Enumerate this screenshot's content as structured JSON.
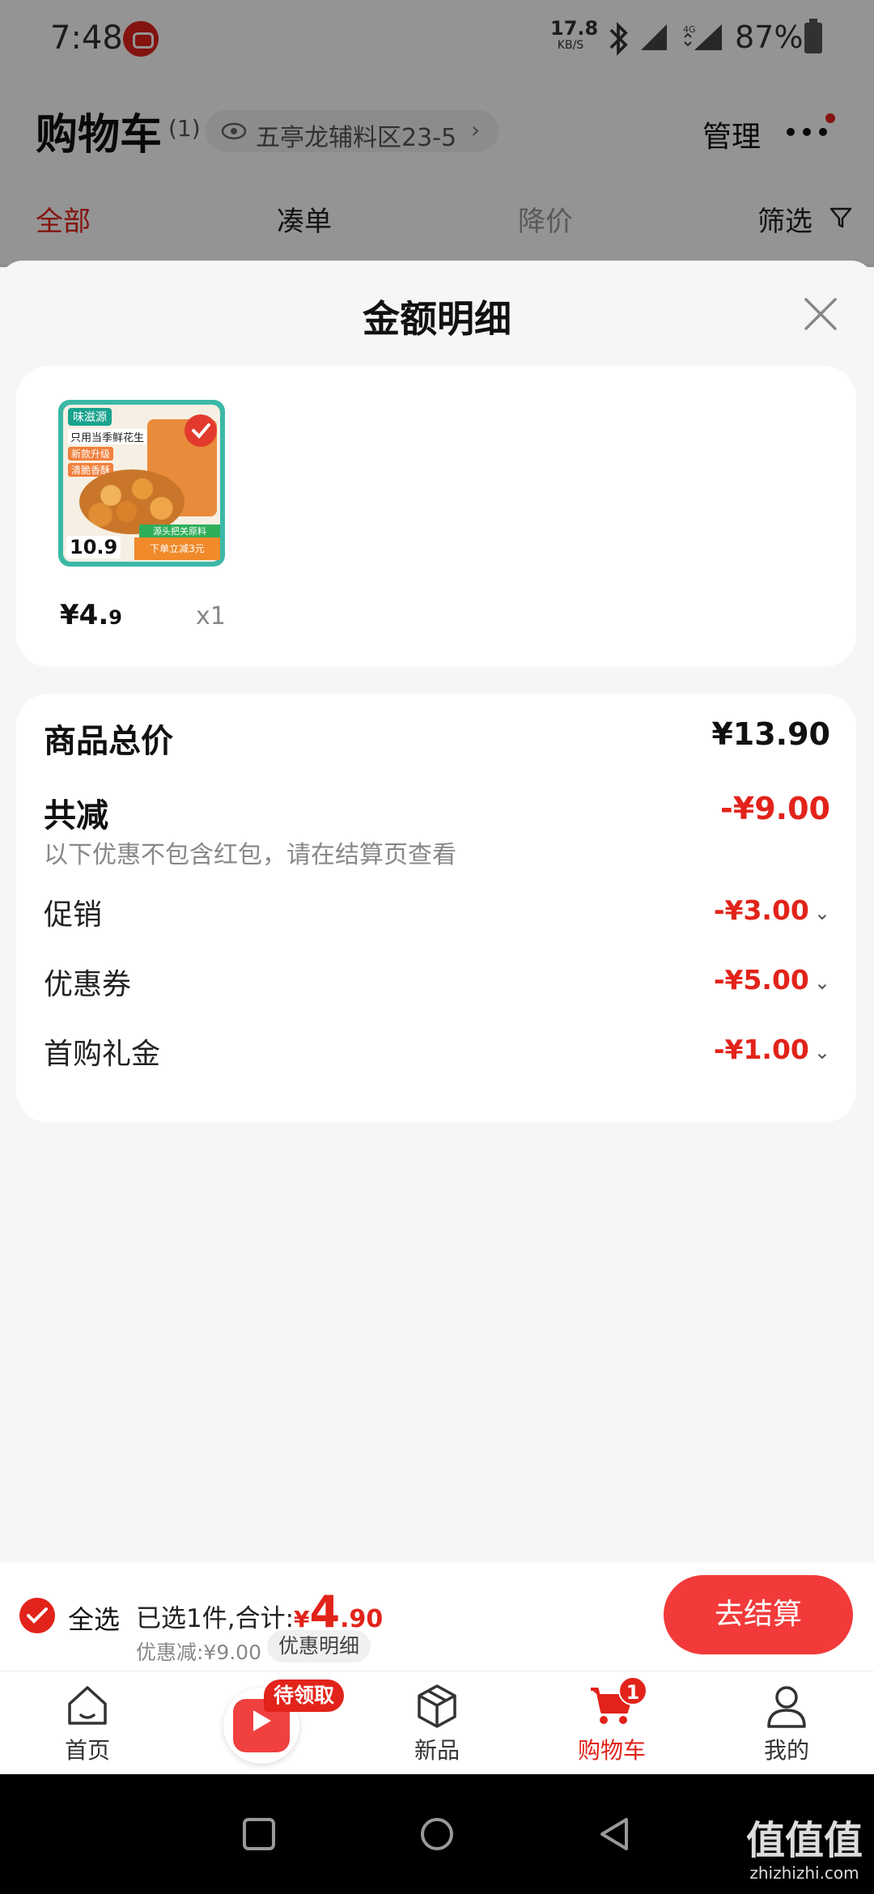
{
  "status_bar": {
    "time": "7:48",
    "net_speed": "17.8",
    "net_unit": "KB/S",
    "battery": "87%"
  },
  "header": {
    "title": "购物车",
    "count": "(1)",
    "location": "五亭龙辅料区23-5",
    "manage": "管理",
    "tabs": [
      "全部",
      "凑单",
      "降价",
      "筛选"
    ]
  },
  "sheet": {
    "title": "金额明细",
    "product": {
      "price_int": "¥4.",
      "price_dec": "9",
      "qty": "x1",
      "image_text": {
        "brand": "味滋源",
        "line1": "只用当季鲜花生",
        "tag1": "新款升级",
        "tag2": "清脆香酥",
        "price": "10.9",
        "green": "源头把关原料",
        "banner": "下单立减3元"
      }
    },
    "summary": {
      "total_label": "商品总价",
      "total_value": "¥13.90",
      "discount_label": "共减",
      "discount_value": "-¥9.00",
      "note": "以下优惠不包含红包，请在结算页查看",
      "items": [
        {
          "label": "促销",
          "value": "-¥3.00"
        },
        {
          "label": "优惠券",
          "value": "-¥5.00"
        },
        {
          "label": "首购礼金",
          "value": "-¥1.00"
        }
      ]
    }
  },
  "checkout": {
    "select_all": "全选",
    "selected_text": "已选1件,合计:",
    "currency": "¥",
    "total_int": "4",
    "total_dec": ".90",
    "discount_text": "优惠减:¥9.00",
    "detail_button": "优惠明细",
    "submit": "去结算"
  },
  "nav": {
    "items": [
      "首页",
      "新品",
      "购物车",
      "我的"
    ],
    "live_badge": "待领取",
    "cart_badge": "1"
  },
  "watermark": {
    "main": "值值值",
    "sub": "zhizhizhi.com"
  },
  "colors": {
    "accent": "#e2231a",
    "button": "#f23a3a"
  }
}
